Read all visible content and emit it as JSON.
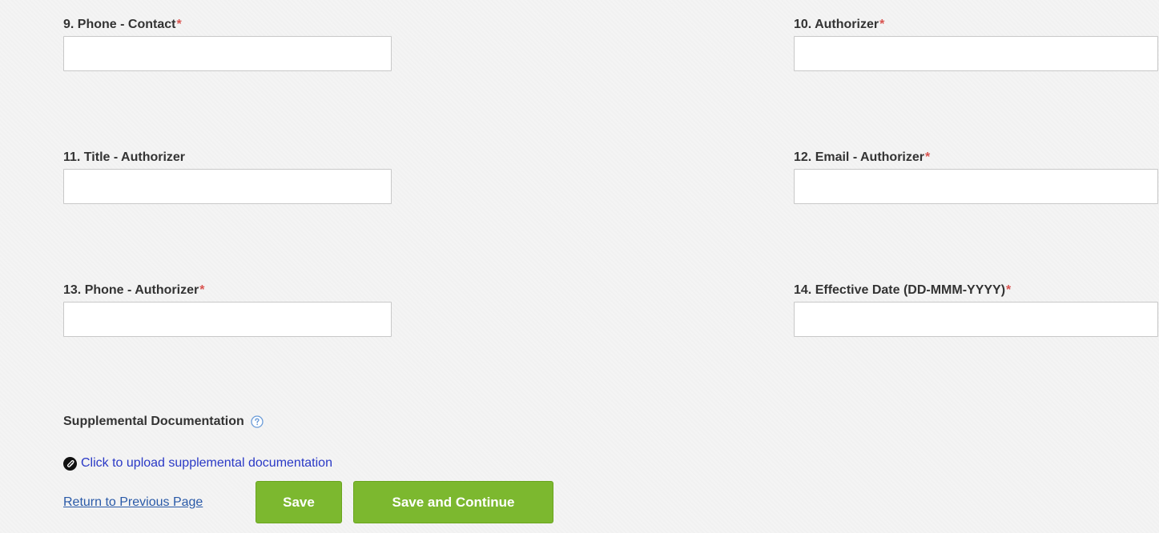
{
  "form": {
    "fields": [
      {
        "label": "9. Phone - Contact",
        "required": "*",
        "value": ""
      },
      {
        "label": "10. Authorizer",
        "required": "*",
        "value": ""
      },
      {
        "label": "11. Title - Authorizer",
        "required": "",
        "value": ""
      },
      {
        "label": "12. Email - Authorizer",
        "required": "*",
        "value": ""
      },
      {
        "label": "13. Phone - Authorizer",
        "required": "*",
        "value": ""
      },
      {
        "label": "14. Effective Date (DD-MMM-YYYY)",
        "required": "*",
        "value": ""
      }
    ]
  },
  "supplemental": {
    "heading": "Supplemental Documentation",
    "help_icon": "question-circle-icon",
    "upload_icon": "paperclip-icon",
    "upload_label": "Click to upload supplemental documentation"
  },
  "actions": {
    "return_label": "Return to Previous Page",
    "save_label": "Save",
    "save_continue_label": "Save and Continue"
  },
  "colors": {
    "required_asterisk": "#d9534f",
    "button_green": "#7cb82f",
    "link_blue": "#2a39c6",
    "background": "#f4f4f4"
  }
}
